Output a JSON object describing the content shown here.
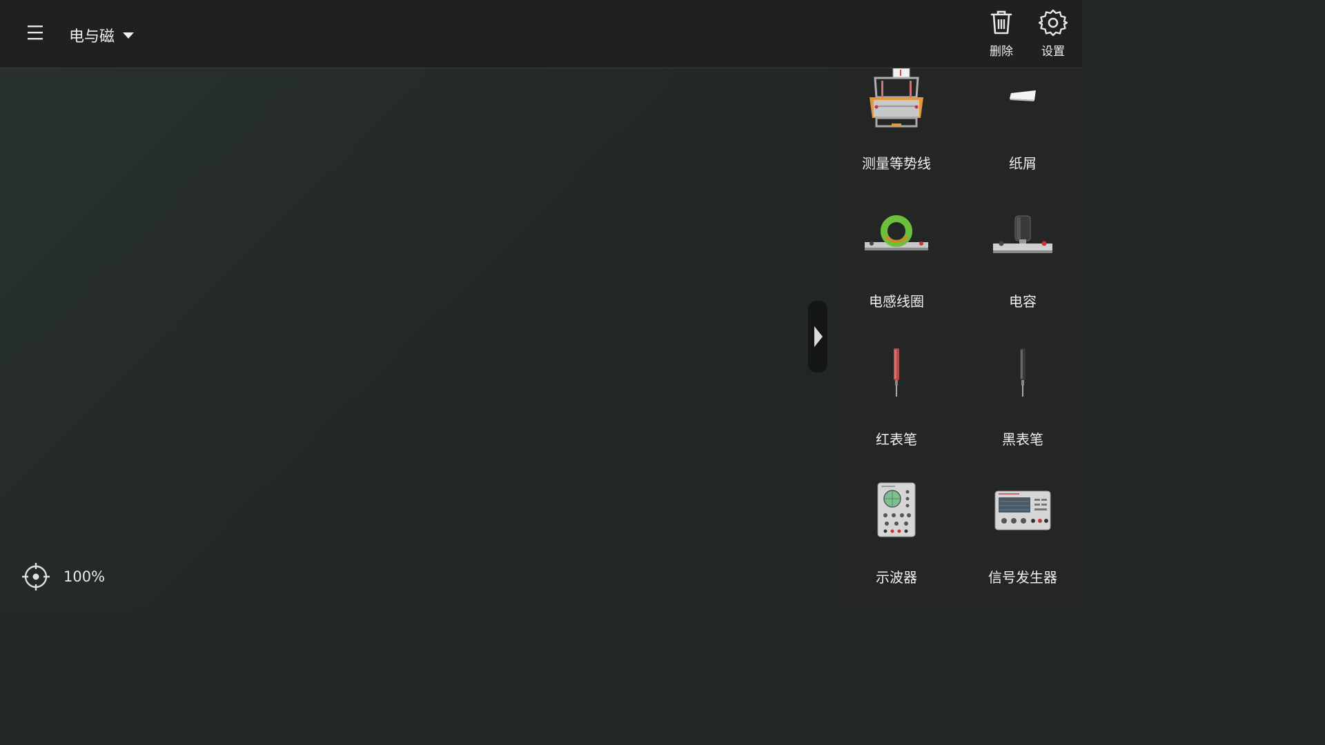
{
  "header": {
    "title": "电与磁",
    "tools": [
      {
        "label": "删除",
        "icon": "trash-icon"
      },
      {
        "label": "设置",
        "icon": "gear-icon"
      }
    ]
  },
  "canvas": {
    "zoom": "100%"
  },
  "panel": {
    "items": [
      {
        "label": "测量等势线",
        "icon": "equipotential-apparatus-icon"
      },
      {
        "label": "纸屑",
        "icon": "paper-scrap-icon"
      },
      {
        "label": "电感线圈",
        "icon": "inductor-coil-icon"
      },
      {
        "label": "电容",
        "icon": "capacitor-icon"
      },
      {
        "label": "红表笔",
        "icon": "red-probe-icon"
      },
      {
        "label": "黑表笔",
        "icon": "black-probe-icon"
      },
      {
        "label": "示波器",
        "icon": "oscilloscope-icon"
      },
      {
        "label": "信号发生器",
        "icon": "signal-generator-icon"
      }
    ]
  }
}
